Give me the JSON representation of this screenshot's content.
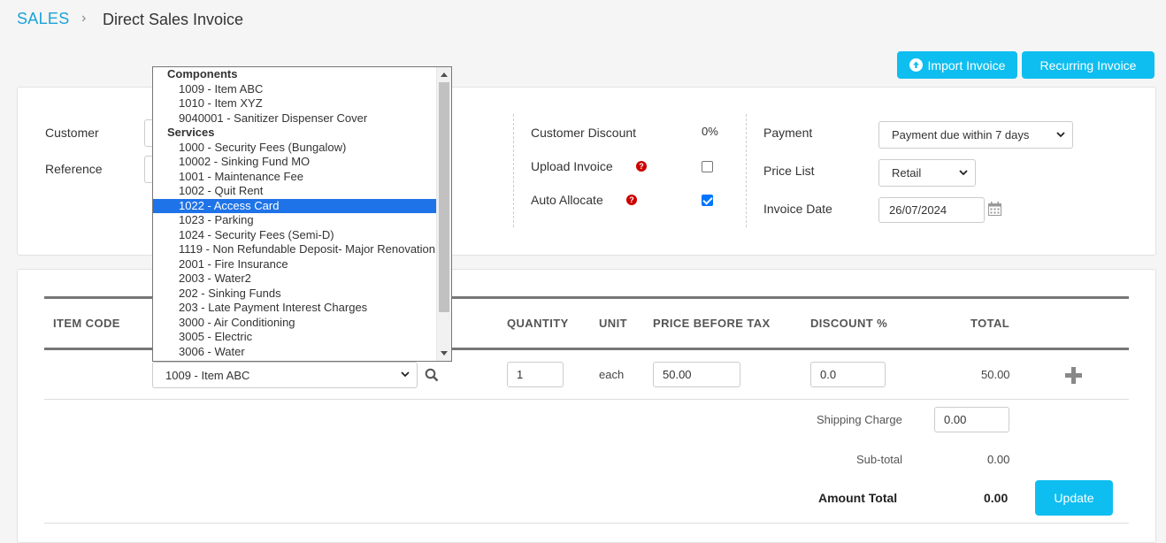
{
  "breadcrumb": {
    "root": "SALES",
    "separator": "›",
    "title": "Direct Sales Invoice"
  },
  "toolbar": {
    "import_label": "Import Invoice",
    "recurring_label": "Recurring Invoice"
  },
  "form": {
    "customer_label": "Customer",
    "reference_label": "Reference",
    "customer_discount_label": "Customer Discount",
    "customer_discount_value": "0%",
    "upload_invoice_label": "Upload Invoice",
    "upload_invoice_checked": false,
    "auto_allocate_label": "Auto Allocate",
    "auto_allocate_checked": true,
    "payment_label": "Payment",
    "payment_value": "Payment due within 7 days",
    "price_list_label": "Price List",
    "price_list_value": "Retail",
    "invoice_date_label": "Invoice Date",
    "invoice_date_value": "26/07/2024"
  },
  "table": {
    "headers": {
      "item_code": "ITEM CODE",
      "quantity": "QUANTITY",
      "unit": "UNIT",
      "price_before_tax": "PRICE BEFORE TAX",
      "discount": "DISCOUNT %",
      "total": "TOTAL"
    },
    "row": {
      "item": "1009 - Item ABC",
      "quantity": "1",
      "unit": "each",
      "price": "50.00",
      "discount": "0.0",
      "total": "50.00"
    }
  },
  "summary": {
    "shipping_label": "Shipping Charge",
    "shipping_value": "0.00",
    "subtotal_label": "Sub-total",
    "subtotal_value": "0.00",
    "amount_total_label": "Amount Total",
    "amount_total_value": "0.00",
    "update_label": "Update"
  },
  "item_dropdown": {
    "groups": [
      {
        "label": "Components",
        "options": [
          "1009 - Item ABC",
          "1010 - Item XYZ",
          "9040001 - Sanitizer Dispenser Cover"
        ]
      },
      {
        "label": "Services",
        "options": [
          "1000 - Security Fees (Bungalow)",
          "10002 - Sinking Fund MO",
          "1001 - Maintenance Fee",
          "1002 - Quit Rent",
          "1022 - Access Card",
          "1023 - Parking",
          "1024 - Security Fees (Semi-D)",
          "1119 - Non Refundable Deposit- Major Renovation",
          "2001 - Fire Insurance",
          "2003 - Water2",
          "202 - Sinking Funds",
          "203 - Late Payment Interest Charges",
          "3000 - Air Conditioning",
          "3005 - Electric",
          "3006 - Water"
        ]
      }
    ],
    "highlighted": "1022 - Access Card"
  },
  "colors": {
    "accent": "#0fbef0",
    "breadcrumb": "#1aa3d9",
    "selection": "#1e73e8",
    "help": "#cc0000"
  },
  "icons": [
    "upload-icon",
    "help-icon",
    "calendar-icon",
    "search-icon",
    "plus-icon",
    "chevron-down-icon"
  ]
}
